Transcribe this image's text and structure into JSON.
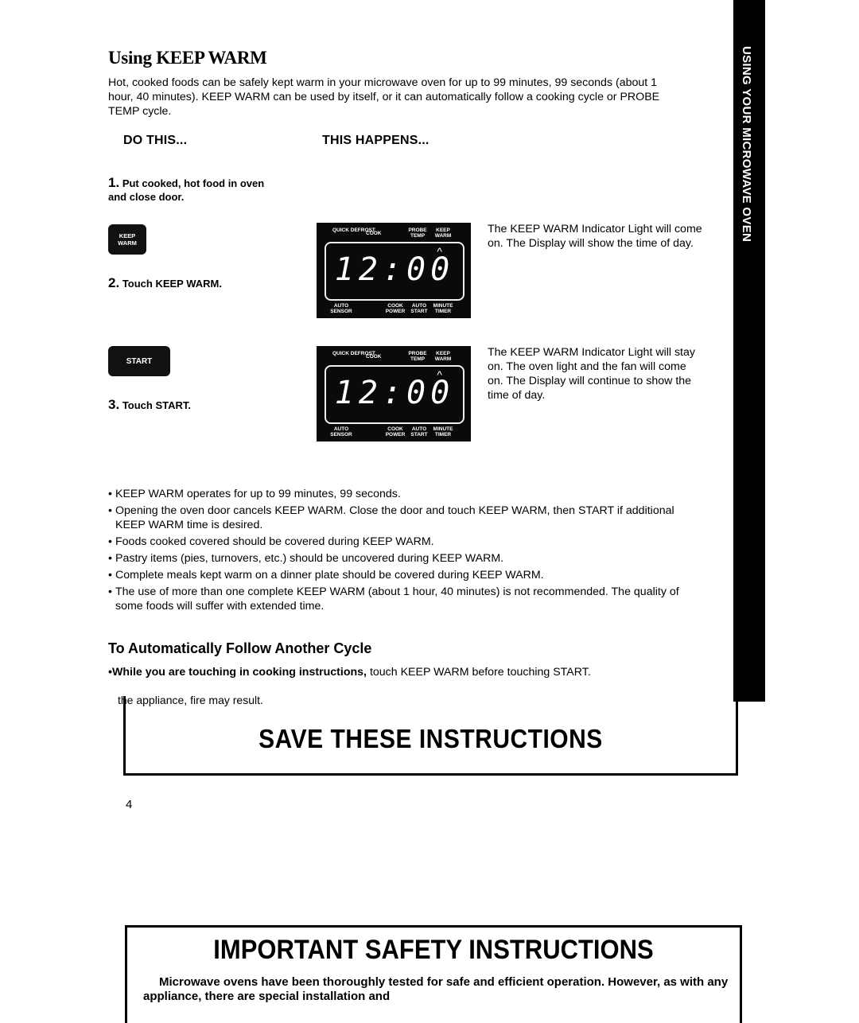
{
  "section_title": "Using KEEP WARM",
  "intro": "Hot, cooked foods can be safely kept warm in your microwave oven for up to 99 minutes, 99 seconds (about 1 hour, 40 minutes). KEEP WARM can be used by itself, or it can automatically follow a cooking cycle or PROBE TEMP cycle.",
  "columns": {
    "do_this": "DO THIS...",
    "this_happens": "THIS HAPPENS..."
  },
  "steps": [
    {
      "num": "1.",
      "text": "Put cooked, hot food in oven and close door."
    },
    {
      "num": "2.",
      "text": "Touch KEEP WARM."
    },
    {
      "num": "3.",
      "text": "Touch START."
    }
  ],
  "keys": {
    "keep_warm_line1": "KEEP",
    "keep_warm_line2": "WARM",
    "start": "START"
  },
  "display": {
    "time": "12:00",
    "top_labels": {
      "quick_defrost": "QUICK DEFROST",
      "cook": "COOK",
      "probe_temp": "PROBE TEMP",
      "keep_warm": "KEEP WARM"
    },
    "bottom_labels": {
      "auto_sensor": "AUTO SENSOR",
      "cook_power": "COOK POWER",
      "auto_start": "AUTO START",
      "minute_timer": "MINUTE TIMER"
    },
    "indicator": "^"
  },
  "results": [
    "The KEEP WARM Indicator Light will come on. The Display will show the time of day.",
    "The KEEP WARM Indicator Light will stay on. The oven light and the fan will come on. The Display will continue to show the time of day."
  ],
  "notes": [
    "KEEP WARM operates for up to 99 minutes, 99 seconds.",
    "Opening the oven door cancels KEEP WARM. Close the door and touch KEEP WARM, then START if additional KEEP WARM time is desired.",
    "Foods cooked covered should be covered during KEEP WARM.",
    "Pastry items (pies, turnovers, etc.) should be uncovered during KEEP WARM.",
    "Complete meals kept warm on a dinner plate should be covered during KEEP WARM.",
    "The use of more than one complete KEEP WARM (about 1 hour, 40 minutes) is not recommended. The quality of some foods will suffer with extended time."
  ],
  "auto_follow": {
    "heading": "To Automatically Follow Another Cycle",
    "bold": "While you are touching in cooking instructions,",
    "rest": " touch KEEP WARM before touching START."
  },
  "overlap_text": "the appliance, fire may result.",
  "save_instructions": "SAVE THESE INSTRUCTIONS",
  "page_number": "4",
  "side_tab": "USING YOUR MICROWAVE OVEN",
  "safety": {
    "title": "IMPORTANT SAFETY INSTRUCTIONS",
    "text": "Microwave ovens have been thoroughly tested for safe and efficient operation. However, as with any appliance, there are special installation and"
  }
}
